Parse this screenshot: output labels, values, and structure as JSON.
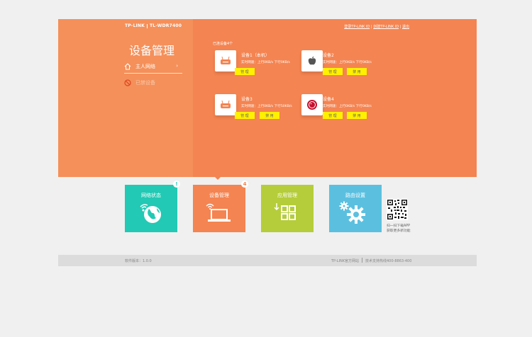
{
  "header": {
    "brand": "TP-LINK",
    "model": "TL-WDR7400",
    "links": [
      "登录TP-LINK ID",
      "创建TP-LINK ID",
      "退出"
    ],
    "page_title": "设备管理",
    "accent_color": "#f48451"
  },
  "sidebar": {
    "items": [
      {
        "label": "主人网络",
        "icon": "home-icon"
      },
      {
        "label": "已禁设备",
        "icon": "ban-icon"
      }
    ]
  },
  "devices": {
    "count_label": "已连设备4个",
    "speed_label": "实时网速：上行0KB/s  下行0KB/s",
    "speed_label_3": "实时网速：上行0KB/s  下行50KB/s",
    "manage_label": "管 理",
    "ban_label": "禁 用",
    "items": [
      {
        "name": "设备1（本机）",
        "icon": "router-icon"
      },
      {
        "name": "设备2",
        "icon": "apple-icon"
      },
      {
        "name": "设备3",
        "icon": "router-icon"
      },
      {
        "name": "设备4",
        "icon": "lg-icon"
      }
    ]
  },
  "tiles": [
    {
      "label": "网络状态",
      "badge": "!",
      "color": "#22c9b4",
      "icon": "globe-icon"
    },
    {
      "label": "设备管理",
      "badge": "4",
      "color": "#f48451",
      "icon": "laptop-wifi-icon"
    },
    {
      "label": "应用管理",
      "badge": "",
      "color": "#b5cd3a",
      "icon": "apps-icon"
    },
    {
      "label": "路由设置",
      "badge": "",
      "color": "#5bc0e0",
      "icon": "gears-icon"
    }
  ],
  "qr": {
    "caption": "扫一扫下载APP获取更多新功能"
  },
  "footer": {
    "version": "软件版本：1.0.0",
    "site": "TP-LINK官方网站",
    "support": "技术支持热线400-8863-400"
  }
}
